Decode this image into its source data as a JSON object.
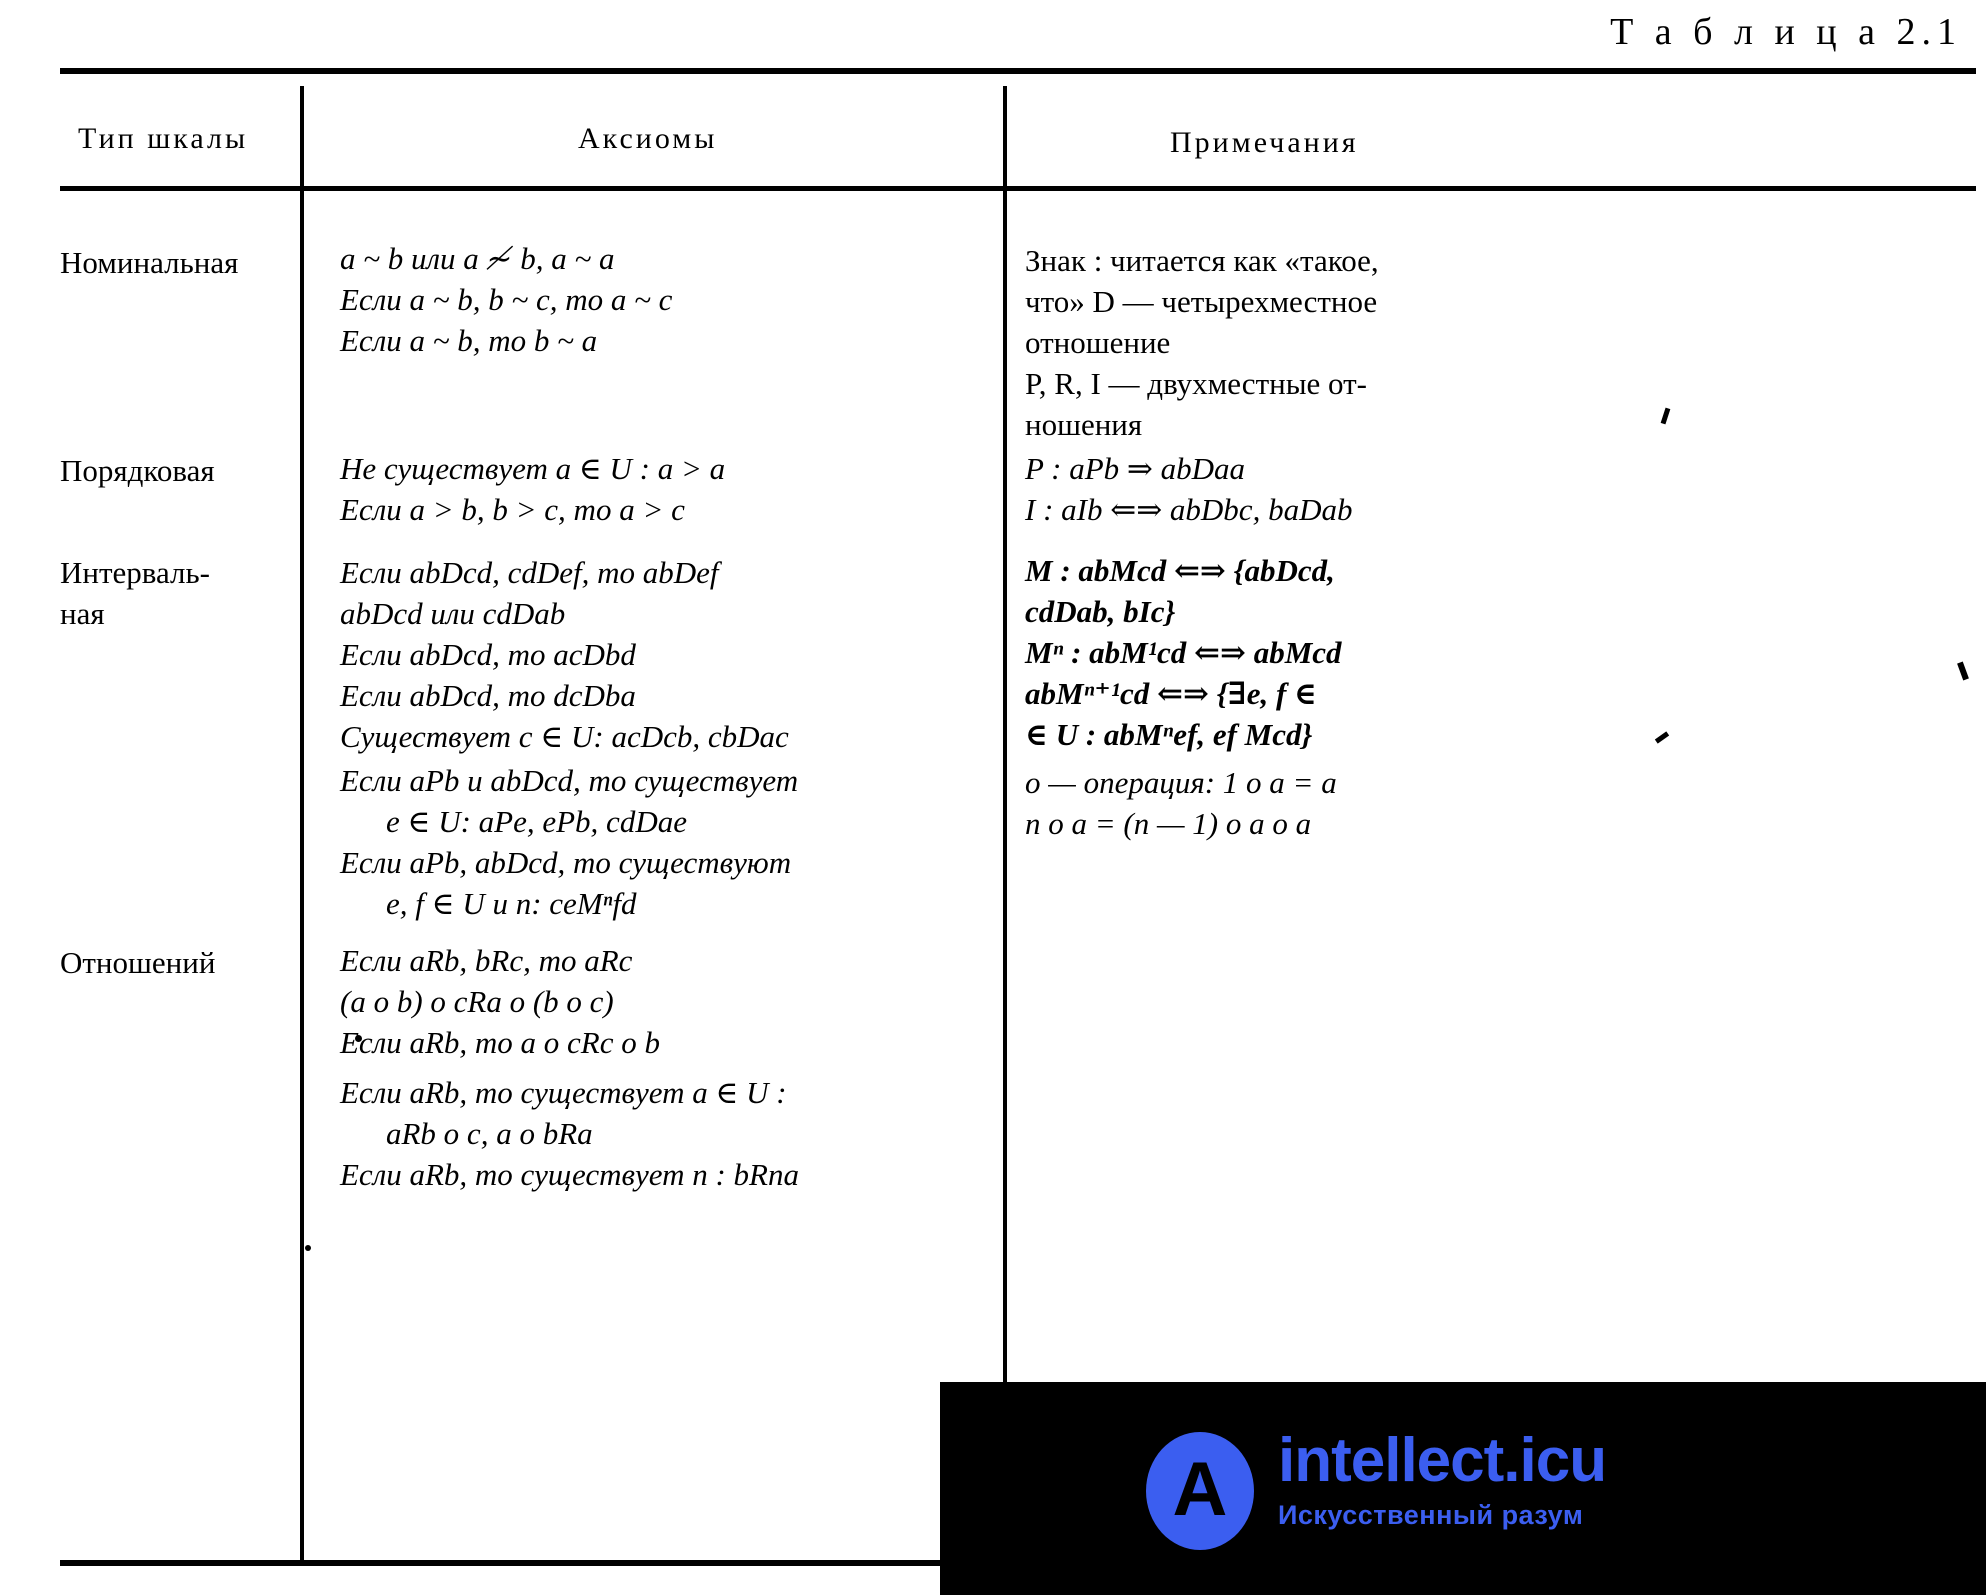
{
  "caption": "Т а б л и ц а  2.1",
  "header": {
    "col_type": "Тип шкалы",
    "col_axioms": "Аксиомы",
    "col_notes": "Примечания"
  },
  "rows": {
    "nominal": {
      "type": "Номинальная",
      "axioms": [
        "a ~ b или a ≁ b,  a ~ a",
        "Если a ~ b,  b ~ c,  то a ~ c",
        "Если a ~ b,  то b ~ a"
      ],
      "notes": [
        "Знак : читается как «такое,",
        "что»  D — четырехместное",
        "отношение",
        "P, R, I — двухместные от-",
        "ношения"
      ]
    },
    "ordinal": {
      "type": "Порядковая",
      "axioms": [
        "Не существует a ∈ U : a > a",
        "Если a > b,  b > c,  то a > c"
      ],
      "notes": [
        "P : aPb ⇒ abDaa",
        "I : aIb ⇐⇒ abDbc,  baDab"
      ]
    },
    "interval": {
      "type": "Интерваль-",
      "type2": "ная",
      "axioms": [
        "Если abDcd,  cdDef,  то abDef",
        "abDcd или cdDab",
        "Если abDcd,  то acDbd",
        "Если abDcd,  то dcDba",
        "Существует c ∈ U:  acDcb,  cbDac"
      ],
      "notes": [
        "M : abMcd ⇐⇒ {abDcd,",
        "cdDab,  bIc}",
        "Mⁿ : abM¹cd ⇐⇒ abMcd",
        "abMⁿ⁺¹cd ⇐⇒ {∃e, f ∈",
        "∈ U : abMⁿef,  ef Mcd}"
      ]
    },
    "interval_cont": {
      "axioms": [
        "Если aPb и abDcd,  то существует",
        "e ∈ U: aPe,  ePb,  cdDae",
        "Если aPb,  abDcd,  то существуют",
        "e, f ∈ U и n: ceMⁿfd"
      ],
      "notes": [
        "о — операция: 1 о a = a",
        "n о a = (n — 1) о a о a"
      ]
    },
    "relation": {
      "type": "Отношений",
      "axioms": [
        "Если aRb,  bRc,  то aRc",
        "(a о b) о cRa о (b о c)",
        "Если aRb,  то a о cRc о b"
      ]
    },
    "relation_cont": {
      "axioms": [
        "Если aRb,  то существует a ∈ U :",
        "aRb о c,  a о bRa",
        "Если aRb,  то существует n : bRna"
      ]
    }
  },
  "watermark": {
    "logo_letter": "A",
    "title": "intellect.icu",
    "subtitle": "Искусственный разум",
    "color": "#3b5ef0",
    "box_color": "#000000"
  }
}
